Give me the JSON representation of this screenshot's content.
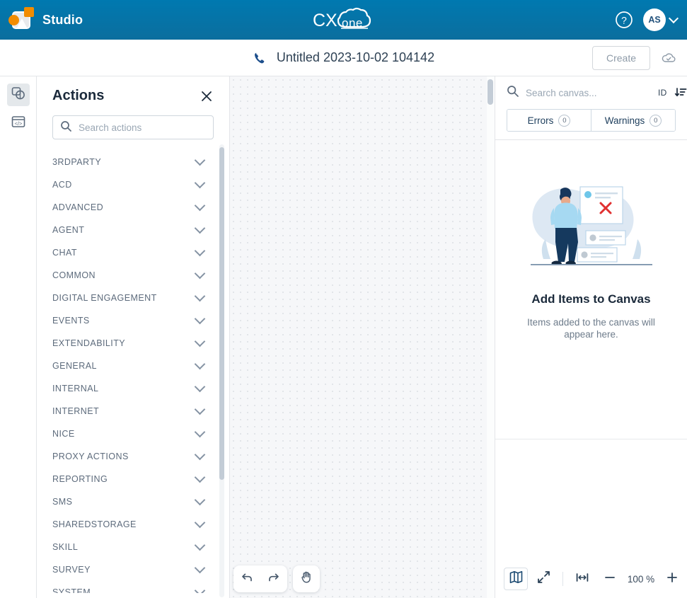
{
  "header": {
    "brand_name": "Studio",
    "logo_icon": "studio-logo-icon",
    "product_logo": "cxone-logo",
    "product_logo_text": "CXone",
    "help_icon": "help-circle-icon",
    "avatar_initials": "AS",
    "avatar_caret_icon": "chevron-down-icon",
    "brand_color": "#0b6e9e"
  },
  "titlebar": {
    "flow_icon": "phone-icon",
    "flow_title": "Untitled 2023-10-02 104142",
    "create_label": "Create",
    "cloud_icon": "cloud-check-icon"
  },
  "rail": {
    "items": [
      {
        "name": "actions-panel-toggle",
        "icon": "shapes-icon",
        "active": true
      },
      {
        "name": "code-panel-toggle",
        "icon": "code-window-icon",
        "active": false
      }
    ]
  },
  "actions": {
    "title": "Actions",
    "close_icon": "close-icon",
    "search": {
      "icon": "search-icon",
      "placeholder": "Search actions",
      "value": ""
    },
    "categories": [
      {
        "label": "3RDPARTY"
      },
      {
        "label": "ACD"
      },
      {
        "label": "ADVANCED"
      },
      {
        "label": "AGENT"
      },
      {
        "label": "CHAT"
      },
      {
        "label": "COMMON"
      },
      {
        "label": "DIGITAL ENGAGEMENT"
      },
      {
        "label": "EVENTS"
      },
      {
        "label": "EXTENDABILITY"
      },
      {
        "label": "GENERAL"
      },
      {
        "label": "INTERNAL"
      },
      {
        "label": "INTERNET"
      },
      {
        "label": "NICE"
      },
      {
        "label": "PROXY ACTIONS"
      },
      {
        "label": "REPORTING"
      },
      {
        "label": "SMS"
      },
      {
        "label": "SHAREDSTORAGE"
      },
      {
        "label": "SKILL"
      },
      {
        "label": "SURVEY"
      },
      {
        "label": "SYSTEM"
      }
    ],
    "chevron_icon": "chevron-down-icon"
  },
  "canvas": {
    "undo_icon": "undo-icon",
    "redo_icon": "redo-icon",
    "pan_icon": "hand-pan-icon",
    "scrollbar": "vertical-scrollbar"
  },
  "rightpanel": {
    "search": {
      "icon": "search-icon",
      "placeholder": "Search canvas...",
      "value": ""
    },
    "id_label": "ID",
    "sort_icon": "sort-descending-icon",
    "tabs": [
      {
        "label": "Errors",
        "count": "0"
      },
      {
        "label": "Warnings",
        "count": "0"
      }
    ],
    "empty_state": {
      "illustration": "empty-canvas-illustration",
      "title": "Add Items to Canvas",
      "subtitle": "Items added to the canvas will appear here."
    },
    "zoombar": {
      "minimap_icon": "minimap-icon",
      "expand_icon": "expand-diagonal-icon",
      "fit_width_icon": "fit-width-icon",
      "zoom_out_icon": "minus-icon",
      "zoom_level": "100 %",
      "zoom_in_icon": "plus-icon"
    }
  }
}
